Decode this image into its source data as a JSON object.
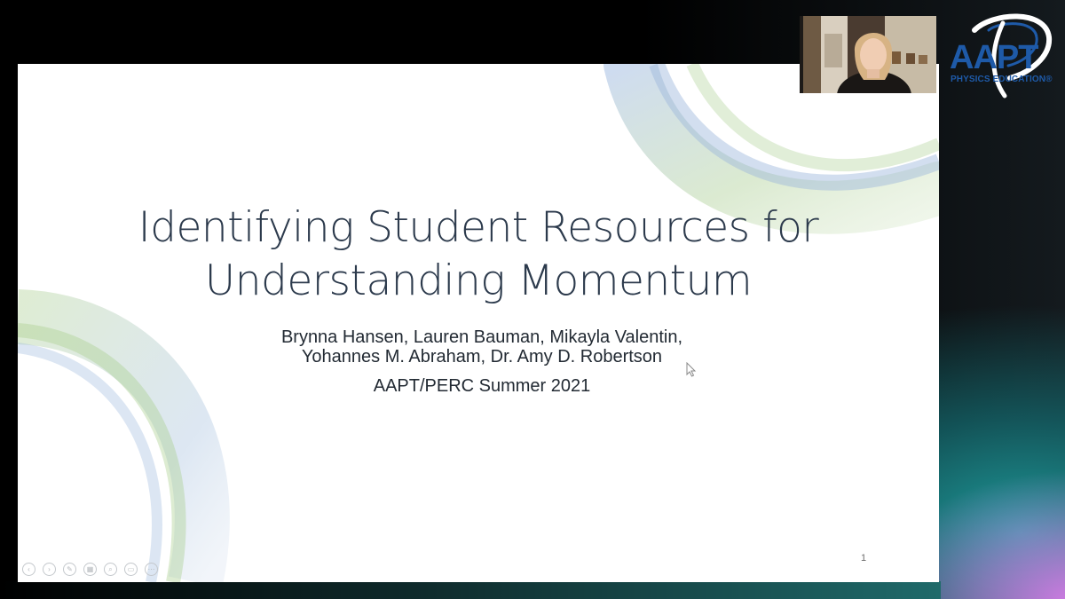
{
  "slide": {
    "title_line_1": "Identifying Student Resources for",
    "title_line_2": "Understanding Momentum",
    "authors_line_1": "Brynna Hansen, Lauren Bauman, Mikayla Valentin,",
    "authors_line_2": "Yohannes M. Abraham, Dr. Amy D. Robertson",
    "conference": "AAPT/PERC Summer 2021",
    "slide_number": "1"
  },
  "logo": {
    "name": "AAPT",
    "tagline": "PHYSICS EDUCATION®",
    "color": "#1e5aa8"
  },
  "nav_controls": [
    {
      "icon": "previous-icon",
      "glyph": "‹"
    },
    {
      "icon": "next-icon",
      "glyph": "›"
    },
    {
      "icon": "pen-icon",
      "glyph": "✎"
    },
    {
      "icon": "slides-grid-icon",
      "glyph": "▦"
    },
    {
      "icon": "zoom-icon",
      "glyph": "⌕"
    },
    {
      "icon": "subtitles-icon",
      "glyph": "▭"
    },
    {
      "icon": "more-icon",
      "glyph": "⋯"
    }
  ],
  "colors": {
    "title": "#2c3a4c",
    "swoosh_green": "#a9cf8e",
    "swoosh_blue": "#9cb6dc"
  }
}
